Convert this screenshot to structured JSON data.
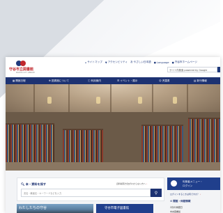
{
  "library": {
    "name": "守谷市立図書館",
    "subtitle": "MORIYA CITY LIBRARY"
  },
  "toplinks": [
    {
      "icon": "home-icon",
      "label": "サイトマップ"
    },
    {
      "icon": "accessibility-icon",
      "label": "アクセシビリティ"
    },
    {
      "icon": "text-size-icon",
      "label": "やさしい日本語"
    },
    {
      "icon": "globe-icon",
      "label": "Language"
    },
    {
      "icon": "phone-icon",
      "label": "守谷市ホームページ"
    }
  ],
  "site_search": {
    "placeholder": "サイト内検索 powered by Google"
  },
  "nav": [
    {
      "icon": "calendar-icon",
      "label": "開館日程"
    },
    {
      "icon": "library-icon",
      "label": "図書館について"
    },
    {
      "icon": "info-icon",
      "label": "利用案内"
    },
    {
      "icon": "event-icon",
      "label": "イベント・展示"
    },
    {
      "icon": "book-icon",
      "label": "児童書"
    },
    {
      "icon": "list-icon",
      "label": "新刊情報"
    }
  ],
  "book_search": {
    "title": "本・資料を探す",
    "help": "資料検索方法がわからない方へ",
    "placeholder": "書名・著者名・キーワードなどを入力",
    "button_icon": "search-icon"
  },
  "cards": {
    "local_title": "わたしたちの守谷",
    "ebook_title": "守谷市電子図書館"
  },
  "side": {
    "menu_line1": "利用者メニュー・",
    "menu_line2": "ログイン",
    "forgot": "ログインするときは何ですか？",
    "hours_title": "開館・休館情報",
    "today": "2月の休館日",
    "main_library": "中央図書館"
  },
  "colors": {
    "accent": "#c0282d",
    "navy": "#1d3272"
  }
}
